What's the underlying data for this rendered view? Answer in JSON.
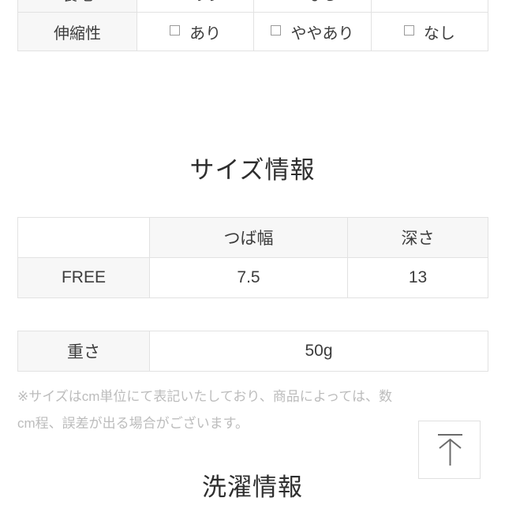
{
  "spec_table": {
    "rows": [
      {
        "label": "裏地",
        "options": [
          "あり",
          "なし",
          ""
        ]
      },
      {
        "label": "伸縮性",
        "options": [
          "あり",
          "ややあり",
          "なし"
        ]
      }
    ],
    "checkbox_icon": "checkbox-empty-icon"
  },
  "size_section": {
    "heading": "サイズ情報",
    "table": {
      "headers": [
        "",
        "つば幅",
        "深さ"
      ],
      "rows": [
        [
          "FREE",
          "7.5",
          "13"
        ]
      ]
    }
  },
  "weight_section": {
    "table": {
      "label": "重さ",
      "value": "50g"
    }
  },
  "note": {
    "line1": "※サイズはcm単位にて表記いたしており、商品によっては、数",
    "line2": "cm程、誤差が出る場合がございます。"
  },
  "back_to_top": {
    "icon": "arrow-up-to-line-icon",
    "label": ""
  },
  "wash_section": {
    "heading": "洗濯情報"
  },
  "colors": {
    "border": "#e2e2e2",
    "cell_head_bg": "#f7f7f7",
    "text": "#3c3c3c",
    "heading": "#2e2e2e",
    "note_text": "#bcbcbc",
    "button_border": "#e0e0e0",
    "arrow": "#6b6b6b"
  }
}
